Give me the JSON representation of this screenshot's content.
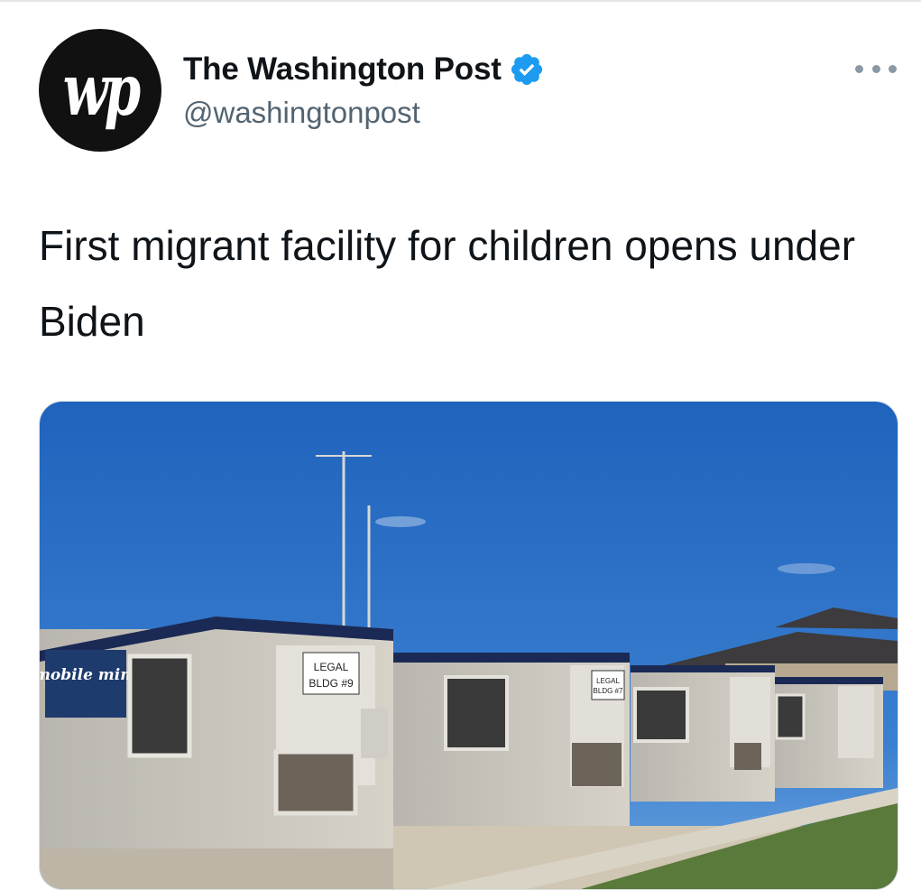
{
  "tweet": {
    "author": {
      "display_name": "The Washington Post",
      "handle": "@washingtonpost",
      "verified": true,
      "avatar_mark": "wp"
    },
    "text": "First migrant facility for children opens under Biden",
    "more_icon": "more-horizontal-icon"
  },
  "card": {
    "image_signs": {
      "company_logo": "mobile mini",
      "sign_1_line1": "LEGAL",
      "sign_1_line2": "BLDG #9",
      "sign_2_line1": "LEGAL",
      "sign_2_line2": "BLDG #7"
    }
  },
  "colors": {
    "verified_blue": "#1d9bf0",
    "handle_gray": "#536471",
    "sky_blue": "#2d6fc4"
  }
}
